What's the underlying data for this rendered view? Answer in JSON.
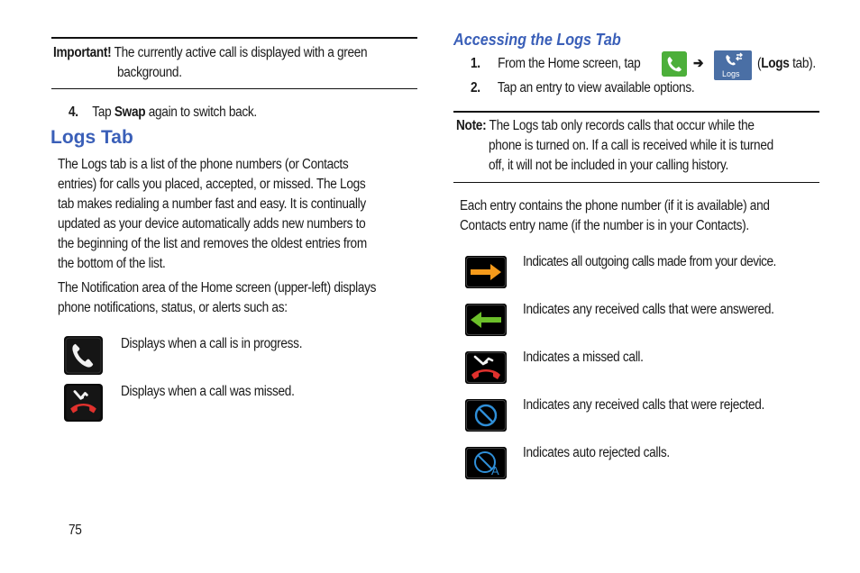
{
  "left": {
    "important": {
      "label": "Important!",
      "line1": "The currently active call is displayed with a green",
      "line2": "background."
    },
    "step4": {
      "number": "4.",
      "pre": "Tap ",
      "bold": "Swap",
      "post": " again to switch back."
    },
    "section_title": "Logs Tab",
    "para1": [
      "The Logs tab is a list of the phone numbers (or Contacts",
      "entries) for calls you placed, accepted, or missed. The Logs",
      "tab makes redialing a number fast and easy. It is continually",
      "updated as your device automatically adds new numbers to",
      "the beginning of the list and removes the oldest entries from",
      "the bottom of the list."
    ],
    "para2": [
      "The Notification area of the Home screen (upper-left) displays",
      "phone notifications, status, or alerts such as:"
    ],
    "notifications": [
      {
        "icon": "call-in-progress-icon",
        "text": "Displays when a call is in progress."
      },
      {
        "icon": "missed-call-icon",
        "text": "Displays when a call was missed."
      }
    ],
    "page_number": "75"
  },
  "right": {
    "section_title": "Accessing the Logs Tab",
    "step1": {
      "number": "1.",
      "pre": "From the Home screen, tap",
      "arrow": "➔",
      "paren_open": "(",
      "bold": "Logs",
      "post": " tab).",
      "logs_icon_label": "Logs"
    },
    "step2": {
      "number": "2.",
      "text": "Tap an entry to view available options."
    },
    "note": {
      "label": "Note:",
      "line1": "The Logs tab only records calls that occur while the",
      "line2": "phone is turned on. If a call is received while it is turned",
      "line3": "off, it will not be included in your calling history."
    },
    "para": [
      "Each entry contains the phone number (if it is available) and",
      "Contacts entry name (if the number is in your Contacts)."
    ],
    "call_types": [
      {
        "icon": "outgoing-call-icon",
        "text": "Indicates all outgoing calls made from your device.",
        "color": "#f59a1b"
      },
      {
        "icon": "received-call-icon",
        "text": "Indicates any received calls that were answered.",
        "color": "#6cbf2a"
      },
      {
        "icon": "missed-call-icon",
        "text": "Indicates a missed call.",
        "color": "#e0312d"
      },
      {
        "icon": "rejected-call-icon",
        "text": "Indicates any received calls that were rejected.",
        "color": "#2f8fd8"
      },
      {
        "icon": "auto-rejected-call-icon",
        "text": "Indicates auto rejected calls.",
        "color": "#2f8fd8"
      }
    ]
  },
  "colors": {
    "heading": "#3a5fb8",
    "phone_app_green": "#4caf3a",
    "logs_tab_blue": "#4a6fa5"
  }
}
